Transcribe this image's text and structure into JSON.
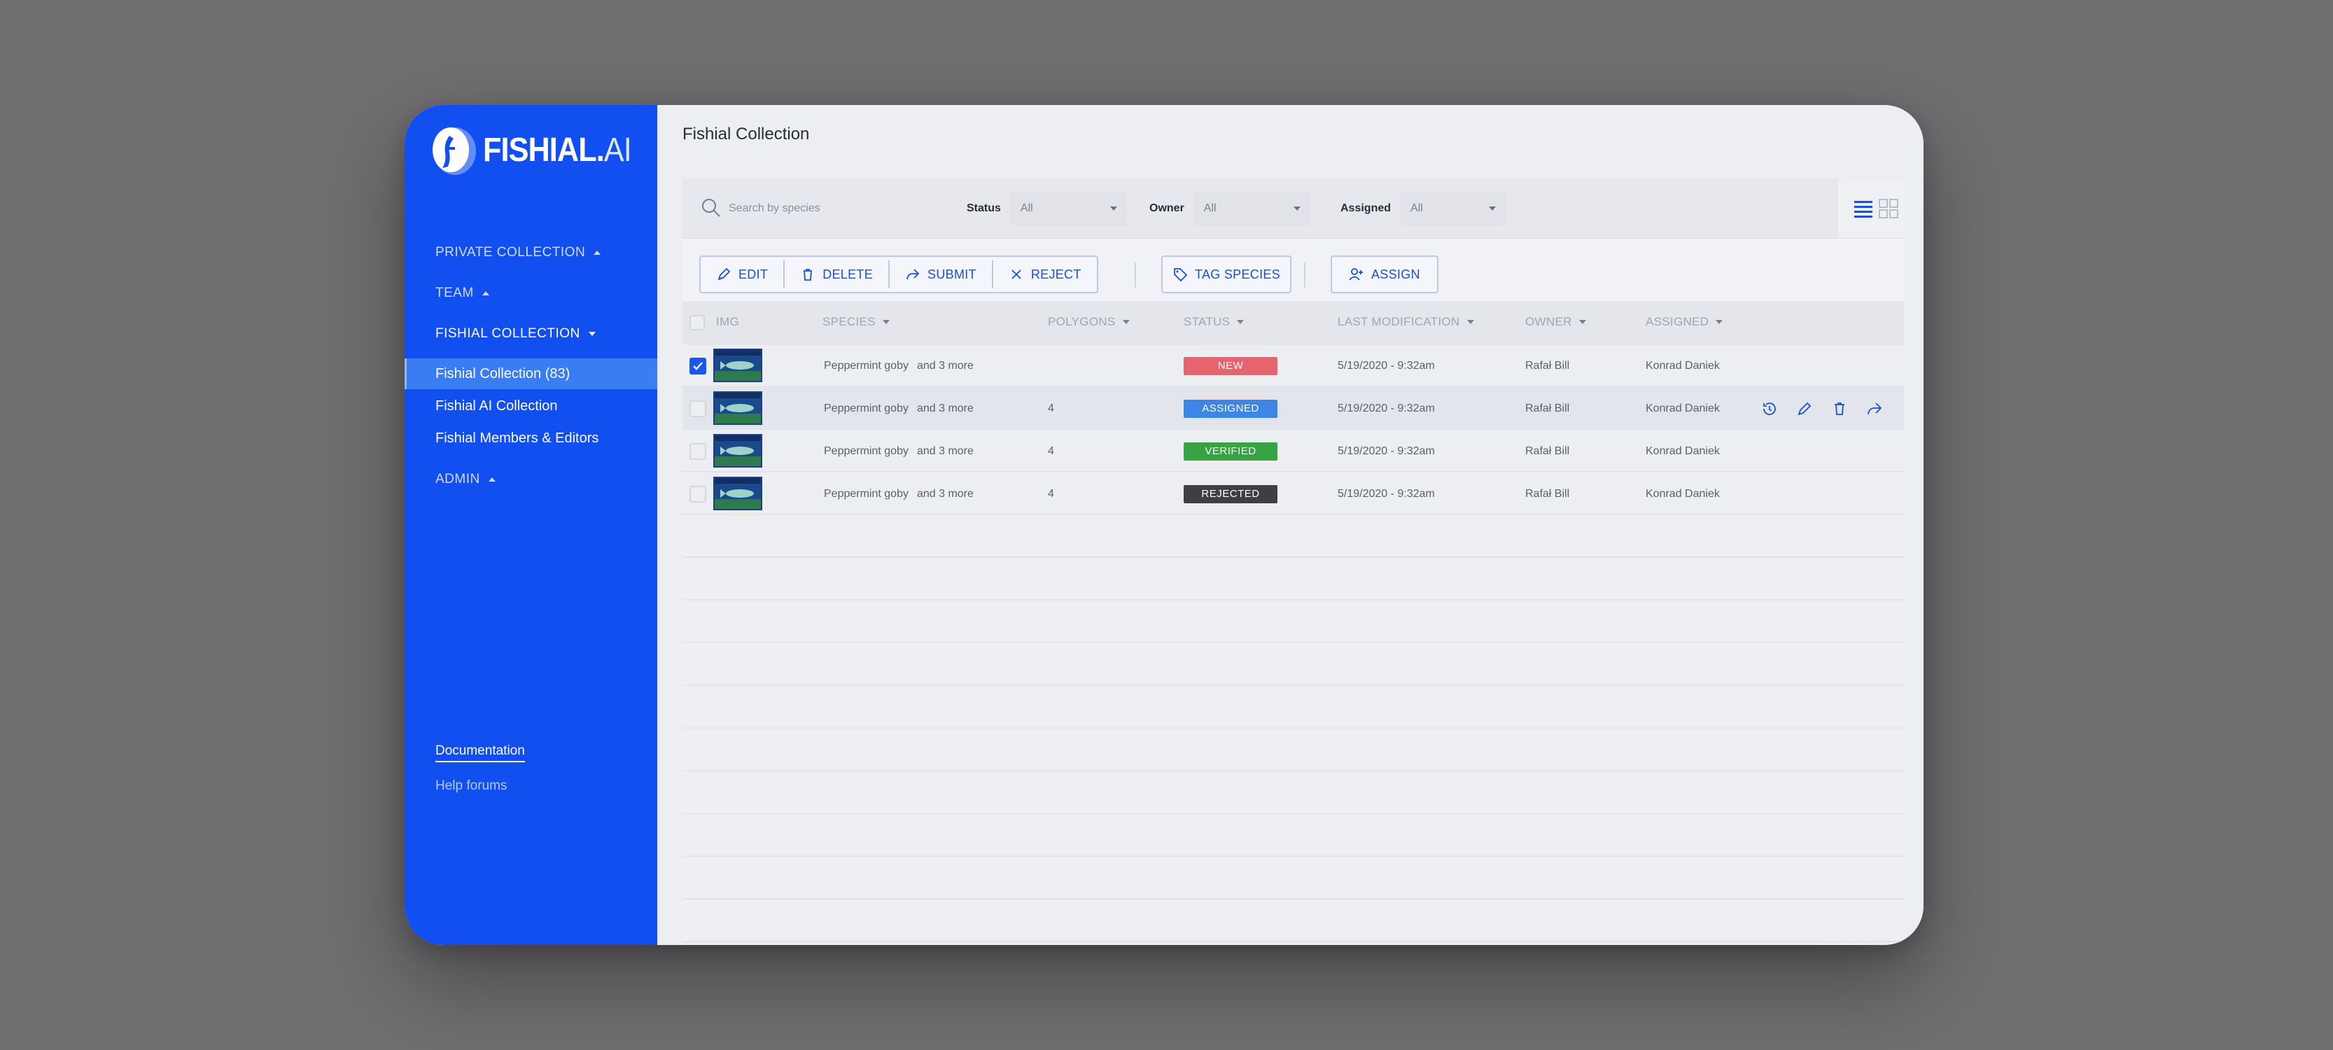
{
  "app": {
    "logo_text": "FISHIAL.",
    "logo_suffix": "AI",
    "page_title": "Fishial Collection"
  },
  "sidebar": {
    "sections": [
      {
        "label": "PRIVATE COLLECTION",
        "state": "collapsed"
      },
      {
        "label": "TEAM",
        "state": "collapsed"
      },
      {
        "label": "FISHIAL COLLECTION",
        "state": "expanded"
      },
      {
        "label": "ADMIN",
        "state": "collapsed"
      }
    ],
    "items": [
      {
        "label": "Fishial Collection (83)",
        "selected": true
      },
      {
        "label": "Fishial AI Collection",
        "selected": false
      },
      {
        "label": "Fishial Members & Editors",
        "selected": false
      }
    ],
    "footer": {
      "documentation": "Documentation",
      "help": "Help forums"
    }
  },
  "filters": {
    "search_placeholder": "Search by species",
    "status": {
      "label": "Status",
      "value": "All"
    },
    "owner": {
      "label": "Owner",
      "value": "All"
    },
    "assigned": {
      "label": "Assigned",
      "value": "All"
    }
  },
  "actions": {
    "edit": "EDIT",
    "delete": "DELETE",
    "submit": "SUBMIT",
    "reject": "REJECT",
    "tag_species": "TAG SPECIES",
    "assign": "ASSIGN"
  },
  "table": {
    "columns": {
      "img": "IMG",
      "species": "SPECIES",
      "polygons": "POLYGONS",
      "status": "STATUS",
      "last_modification": "LAST MODIFICATION",
      "owner": "OWNER",
      "assigned": "ASSIGNED"
    },
    "rows": [
      {
        "checked": true,
        "species": "Peppermint goby",
        "more": "and 3 more",
        "polygons": "",
        "status": "NEW",
        "status_color": "#e5646e",
        "modified": "5/19/2020 - 9:32am",
        "owner": "Rafał Bill",
        "assigned": "Konrad Daniek"
      },
      {
        "checked": false,
        "species": "Peppermint goby",
        "more": "and 3 more",
        "polygons": "4",
        "status": "ASSIGNED",
        "status_color": "#3d86e6",
        "modified": "5/19/2020 - 9:32am",
        "owner": "Rafał Bill",
        "assigned": "Konrad Daniek"
      },
      {
        "checked": false,
        "species": "Peppermint goby",
        "more": "and 3 more",
        "polygons": "4",
        "status": "VERIFIED",
        "status_color": "#38a343",
        "modified": "5/19/2020 - 9:32am",
        "owner": "Rafał Bill",
        "assigned": "Konrad Daniek"
      },
      {
        "checked": false,
        "species": "Peppermint goby",
        "more": "and 3 more",
        "polygons": "4",
        "status": "REJECTED",
        "status_color": "#3f3f42",
        "modified": "5/19/2020 - 9:32am",
        "owner": "Rafał Bill",
        "assigned": "Konrad Daniek"
      }
    ]
  },
  "colors": {
    "sidebar": "#114ff0",
    "selected_item": "#3a7df2",
    "accent": "#1a4fd8"
  }
}
